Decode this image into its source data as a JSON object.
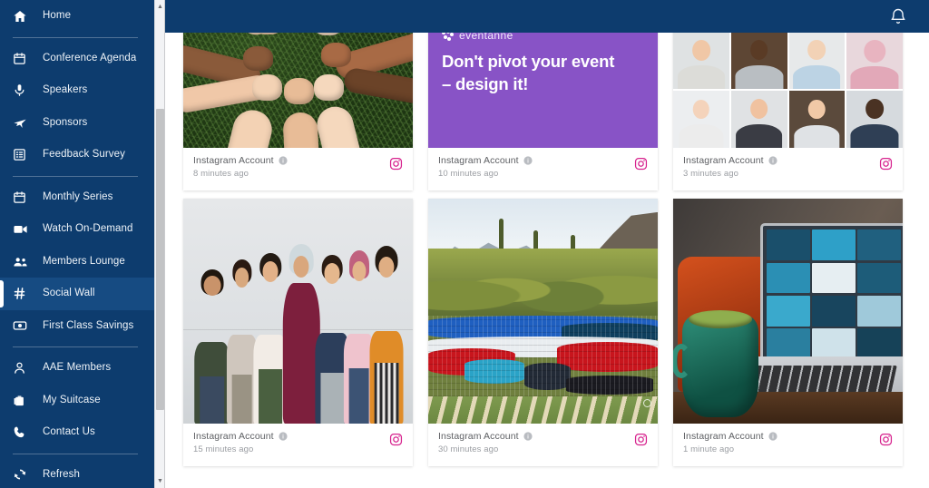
{
  "app": {
    "accent_dark_blue": "#0d3c6e",
    "accent_active_blue": "#164b82",
    "instagram_pink": "#d7238e",
    "page_background": "#ffffff"
  },
  "header": {
    "notification_icon": "bell-icon",
    "notification_label": "Notifications"
  },
  "scrollbar": {
    "up_arrow": "▲",
    "down_arrow": "▼"
  },
  "sidebar": {
    "items": [
      {
        "label": "Home",
        "icon": "home-icon",
        "active": false,
        "divider_after": true
      },
      {
        "label": "Conference Agenda",
        "icon": "calendar-icon",
        "active": false,
        "divider_after": false
      },
      {
        "label": "Speakers",
        "icon": "microphone-icon",
        "active": false,
        "divider_after": false
      },
      {
        "label": "Sponsors",
        "icon": "airplane-icon",
        "active": false,
        "divider_after": false
      },
      {
        "label": "Feedback Survey",
        "icon": "survey-icon",
        "active": false,
        "divider_after": true
      },
      {
        "label": "Monthly Series",
        "icon": "calendar-icon",
        "active": false,
        "divider_after": false
      },
      {
        "label": "Watch On-Demand",
        "icon": "video-camera-icon",
        "active": false,
        "divider_after": false
      },
      {
        "label": "Members Lounge",
        "icon": "people-group-icon",
        "active": false,
        "divider_after": false
      },
      {
        "label": "Social Wall",
        "icon": "hashtag-icon",
        "active": true,
        "divider_after": false
      },
      {
        "label": "First Class Savings",
        "icon": "money-icon",
        "active": false,
        "divider_after": true
      },
      {
        "label": "AAE Members",
        "icon": "person-icon",
        "active": false,
        "divider_after": false
      },
      {
        "label": "My Suitcase",
        "icon": "briefcase-icon",
        "active": false,
        "divider_after": false
      },
      {
        "label": "Contact Us",
        "icon": "phone-icon",
        "active": false,
        "divider_after": true
      },
      {
        "label": "Refresh",
        "icon": "refresh-icon",
        "active": false,
        "divider_after": false
      }
    ]
  },
  "social_wall": {
    "posts": [
      {
        "account": "Instagram Account",
        "time": "8 minutes ago",
        "network_icon": "instagram-icon",
        "info_icon": "info-icon",
        "media": "hands-fists-circle-on-grass",
        "media_alt": "Group of diverse hands forming a circle of fists over grass"
      },
      {
        "account": "Instagram Account",
        "time": "10 minutes ago",
        "network_icon": "instagram-icon",
        "info_icon": "info-icon",
        "media": "eventanne-purple-graphic",
        "media_alt": "Purple promotional graphic over stone wall photo",
        "brand": "eventanne",
        "headline_line1": "Don't pivot your event",
        "headline_line2": "– design it!"
      },
      {
        "account": "Instagram Account",
        "time": "3 minutes ago",
        "network_icon": "instagram-icon",
        "info_icon": "info-icon",
        "media": "video-call-grid-portraits",
        "media_alt": "Grid of twelve smiling people in a video conference"
      },
      {
        "account": "Instagram Account",
        "time": "15 minutes ago",
        "network_icon": "instagram-icon",
        "info_icon": "info-icon",
        "media": "women-laughing-against-wall",
        "media_alt": "Seven women laughing together leaning against a grey wall"
      },
      {
        "account": "Instagram Account",
        "time": "30 minutes ago",
        "network_icon": "instagram-icon",
        "info_icon": "info-icon",
        "media": "large-company-group-photo-desert",
        "media_alt": "Large company group photo outdoors in a desert landscape"
      },
      {
        "account": "Instagram Account",
        "time": "1 minute ago",
        "network_icon": "instagram-icon",
        "info_icon": "info-icon",
        "media": "laptop-video-call-with-mug",
        "media_alt": "Laptop showing a video call next to a green mug"
      }
    ]
  }
}
